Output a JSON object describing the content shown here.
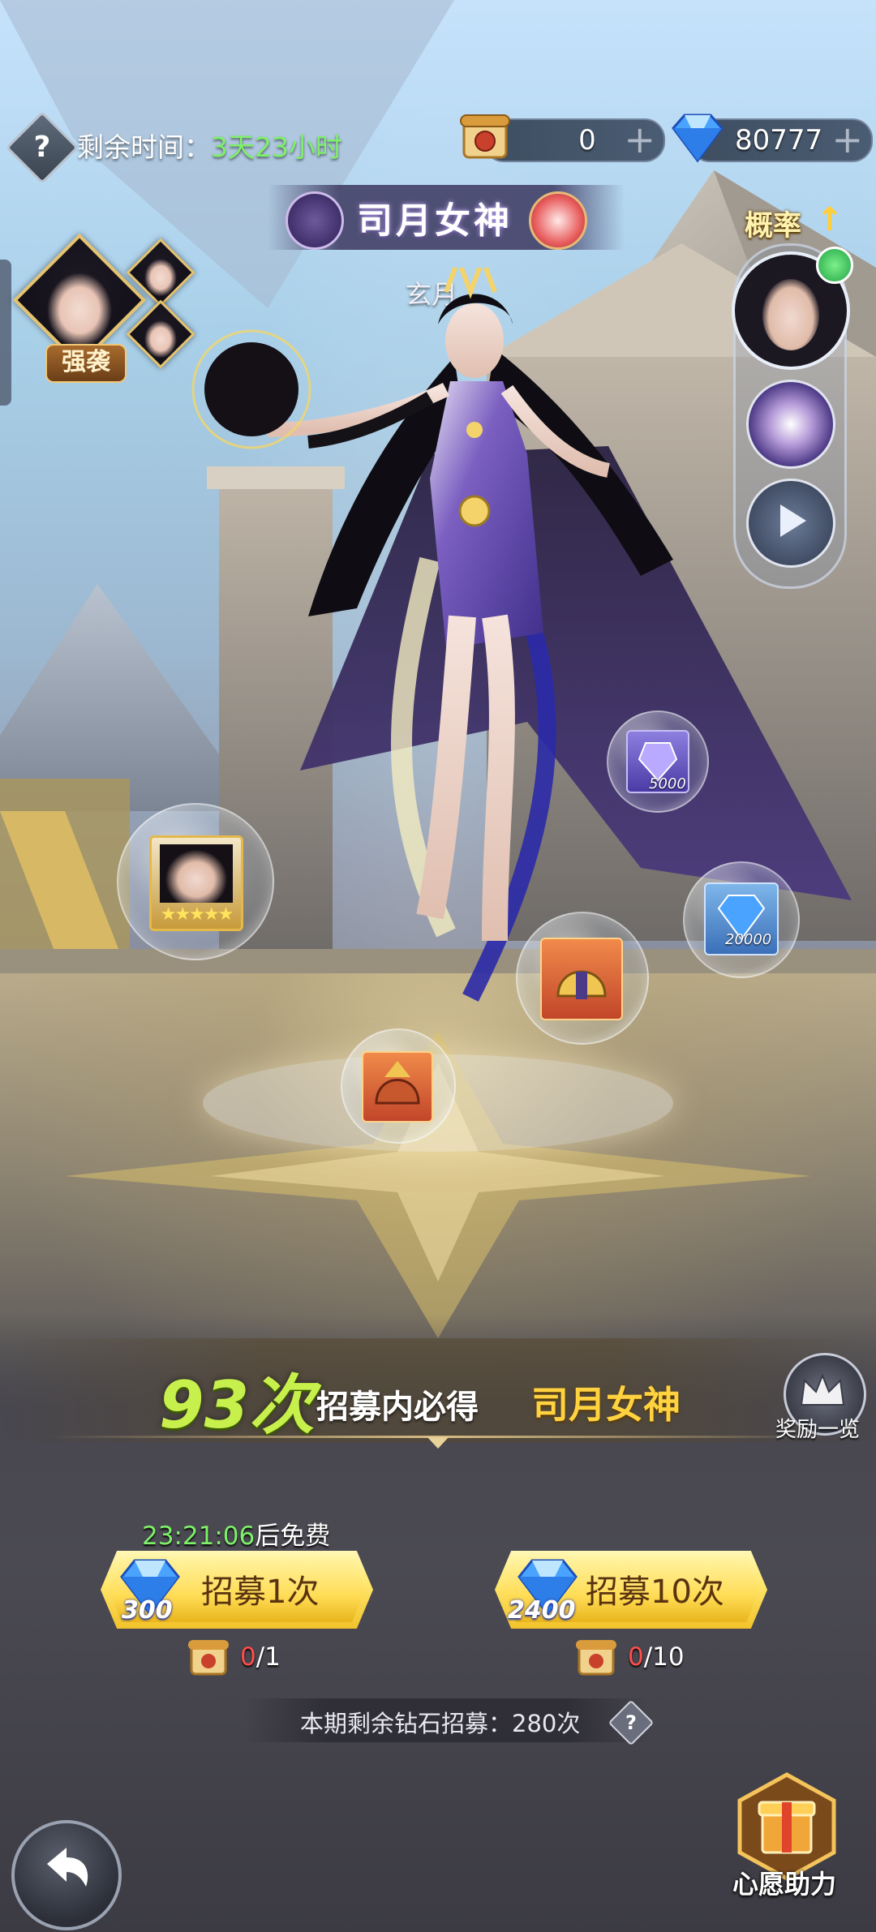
{
  "top_bar": {
    "help_glyph": "?",
    "time_label": "剩余时间：",
    "time_value": "3天23小时",
    "scroll_count": "0",
    "diamond_count": "80777",
    "plus_glyph": "+"
  },
  "banner": {
    "title": "司月女神",
    "subtitle": "玄月"
  },
  "left_panel": {
    "raid_label": "强袭"
  },
  "right_panel": {
    "probability_label": "概率",
    "probability_arrow": "↑"
  },
  "orbs": [
    {
      "item": "hero-card-5star",
      "amount": ""
    },
    {
      "item": "diamond-shard",
      "amount": "5000"
    },
    {
      "item": "diamond",
      "amount": "20000"
    },
    {
      "item": "golden-helmet",
      "amount": ""
    },
    {
      "item": "crimson-helmet",
      "amount": ""
    }
  ],
  "guarantee": {
    "count": "93次",
    "middle": "招募内必得",
    "name": "司月女神"
  },
  "reward_overview": {
    "label": "奖励一览"
  },
  "recruit": {
    "free_timer": "23:21:06",
    "free_suffix": "后免费",
    "single": {
      "label": "招募1次",
      "cost": "300",
      "ticket_have": "0",
      "ticket_need": "/1"
    },
    "ten": {
      "label": "招募10次",
      "cost": "2400",
      "ticket_have": "0",
      "ticket_need": "/10"
    }
  },
  "remaining": {
    "text": "本期剩余钻石招募：280次",
    "help_glyph": "?"
  },
  "bottom": {
    "wish_label": "心愿助力"
  },
  "colors": {
    "accent_green": "#7ef06a",
    "gold": "#ffd23f",
    "button_gold": "#ffdc55",
    "ticket_zero": "#ff4d4d"
  }
}
